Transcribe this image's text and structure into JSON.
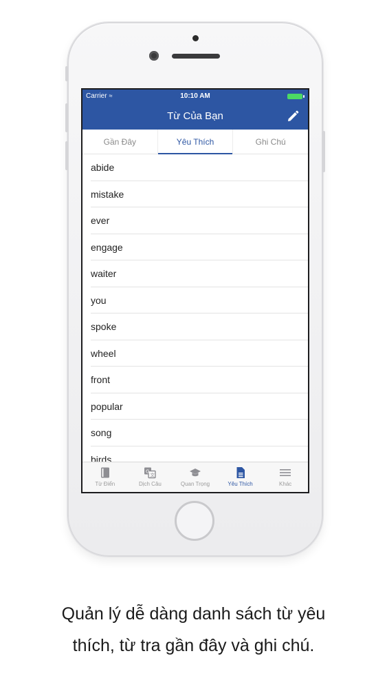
{
  "status_bar": {
    "carrier": "Carrier",
    "time": "10:10 AM"
  },
  "nav": {
    "title": "Từ Của Bạn",
    "edit_icon": "pencil-icon"
  },
  "segments": [
    {
      "label": "Gần Đây",
      "active": false
    },
    {
      "label": "Yêu Thích",
      "active": true
    },
    {
      "label": "Ghi Chú",
      "active": false
    }
  ],
  "words": [
    "abide",
    "mistake",
    "ever",
    "engage",
    "waiter",
    "you",
    "spoke",
    "wheel",
    "front",
    "popular",
    "song",
    "birds"
  ],
  "tabs": [
    {
      "label": "Từ Điển",
      "icon": "book-icon",
      "active": false
    },
    {
      "label": "Dịch Câu",
      "icon": "translate-icon",
      "active": false
    },
    {
      "label": "Quan Trọng",
      "icon": "graduation-cap-icon",
      "active": false
    },
    {
      "label": "Yêu Thích",
      "icon": "document-icon",
      "active": true
    },
    {
      "label": "Khác",
      "icon": "menu-icon",
      "active": false
    }
  ],
  "caption": {
    "line1": "Quản lý dễ dàng danh sách từ yêu",
    "line2": "thích, từ tra gần đây và ghi chú."
  },
  "colors": {
    "nav_bar": "#2d56a3",
    "accent": "#2d56a3",
    "battery": "#4cd964"
  }
}
